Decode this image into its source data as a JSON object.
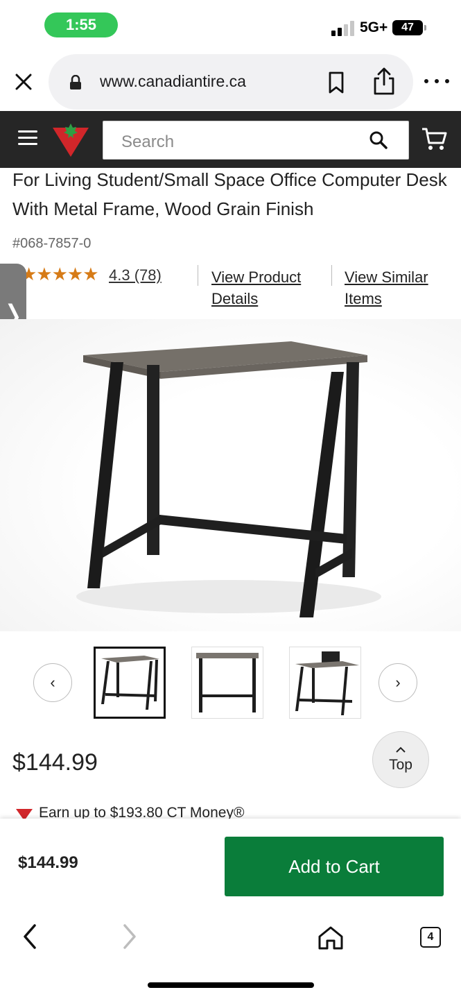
{
  "status_bar": {
    "time": "1:55",
    "network": "5G+",
    "battery": "47"
  },
  "browser": {
    "url": "www.canadiantire.ca",
    "tab_count": "4"
  },
  "site_header": {
    "search_placeholder": "Search"
  },
  "product": {
    "title": "For Living Student/Small Space Office Computer Desk With Metal Frame, Wood Grain Finish",
    "sku": "#068-7857-0",
    "stars_display": "★★★★★",
    "rating_value": 4.3,
    "rating": "4.3 (78)",
    "link_details": "View Product Details",
    "link_similar": "View Similar Items",
    "price": "$144.99",
    "ct_money": "Earn up to $193.80 CT Money®"
  },
  "side_tab": {
    "icon": "chevron-right-icon",
    "glyph": "❭"
  },
  "gallery": {
    "prev_glyph": "‹",
    "next_glyph": "›",
    "selected_index": 0,
    "thumb_count": 3
  },
  "top_button": {
    "label": "Top"
  },
  "sticky": {
    "price": "$144.99",
    "add_to_cart": "Add to Cart"
  },
  "colors": {
    "header_bg": "#262626",
    "brand_red": "#d1262a",
    "add_to_cart_green": "#0a7d3a",
    "star_orange": "#d67b17",
    "time_pill_green": "#34c759"
  }
}
